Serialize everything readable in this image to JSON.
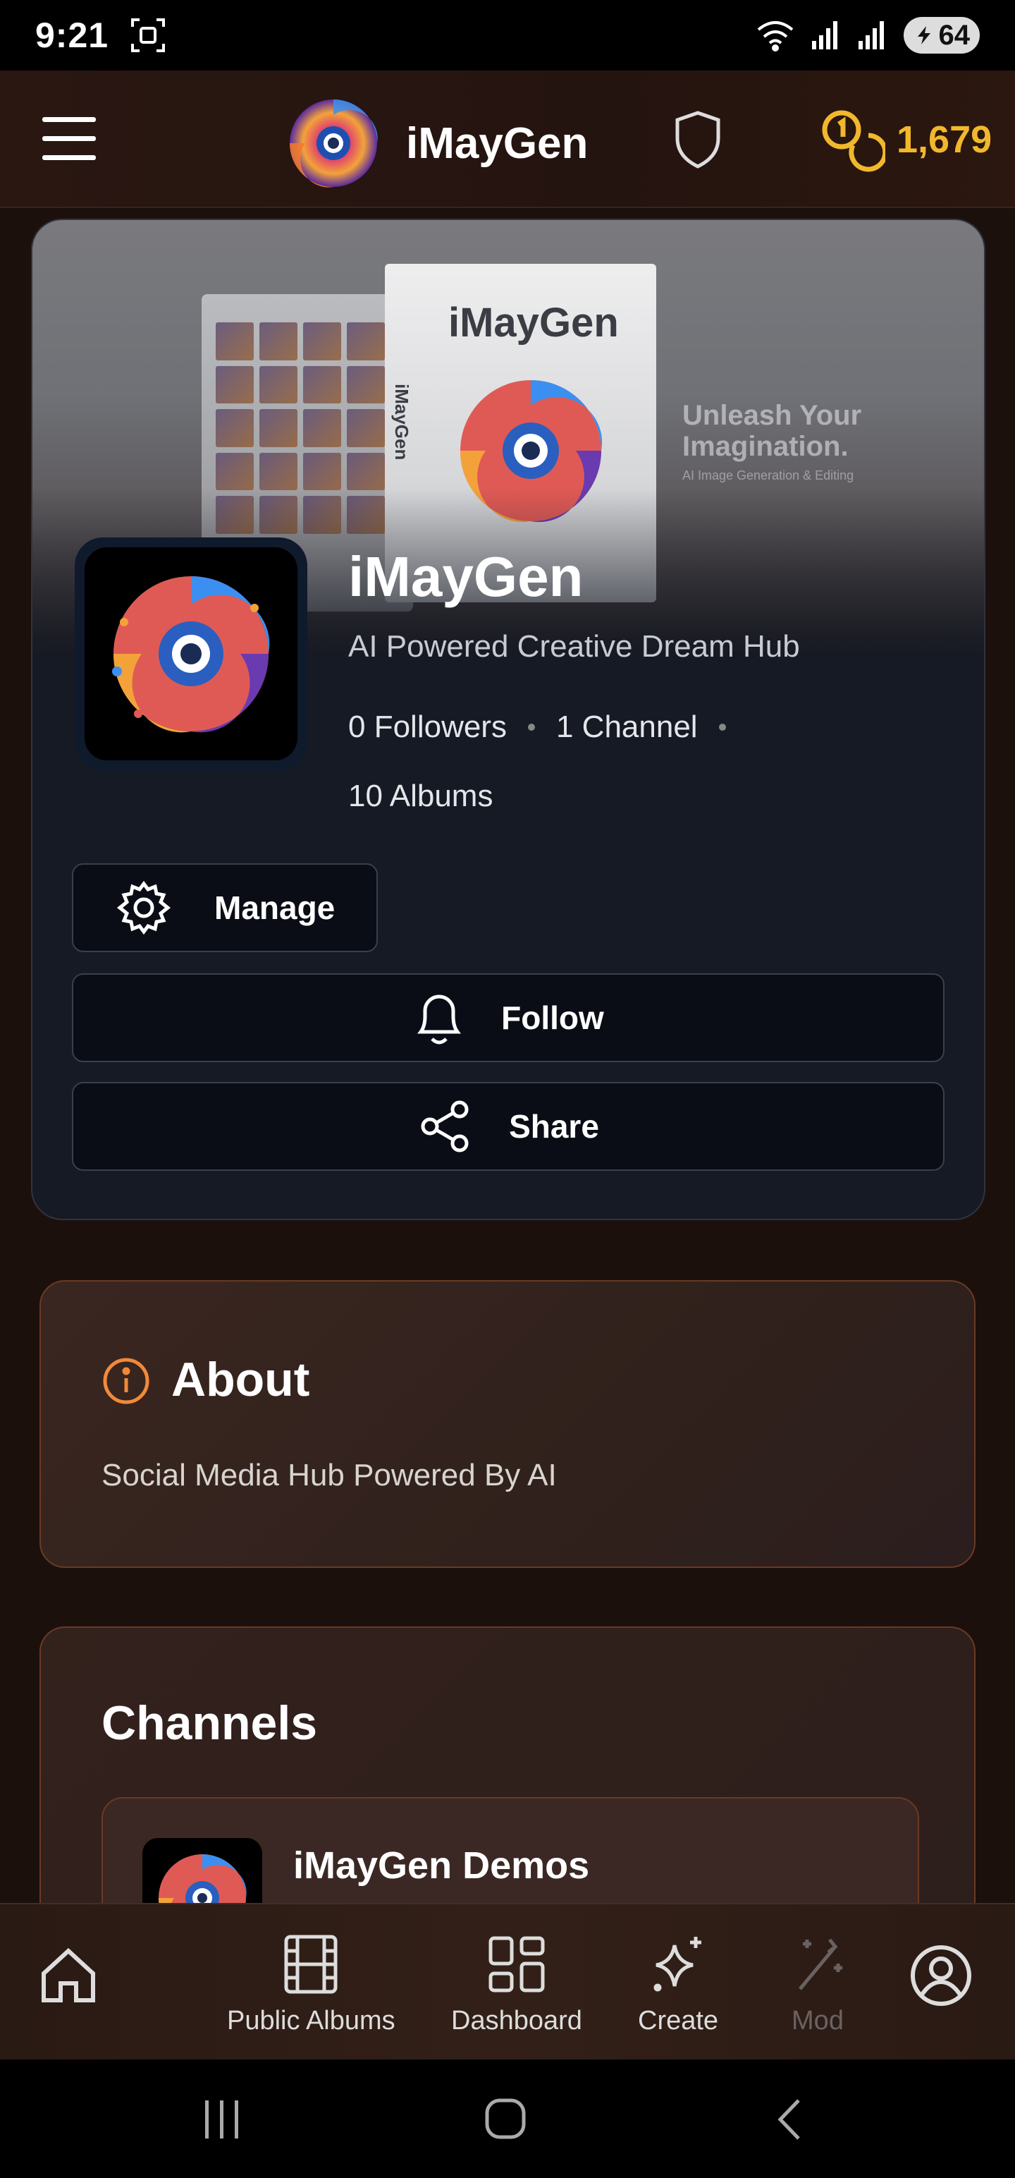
{
  "status_bar": {
    "time": "9:21",
    "battery": "64",
    "icons": [
      "screenshot-icon",
      "wifi-icon",
      "signal-icon",
      "signal-icon",
      "battery-icon"
    ]
  },
  "header": {
    "app_name": "iMayGen",
    "coins": "1,679",
    "icons": [
      "menu-icon",
      "shield-icon",
      "coins-icon"
    ]
  },
  "banner": {
    "box_title": "iMayGen",
    "box_spine": "iMayGen",
    "tagline": "Unleash Your Imagination.",
    "tagline_sub": "AI Image Generation & Editing"
  },
  "profile": {
    "name": "iMayGen",
    "tagline": "AI Powered Creative Dream Hub",
    "followers": "0 Followers",
    "channels": "1 Channel",
    "albums": "10 Albums",
    "manage_label": "Manage",
    "follow_label": "Follow",
    "share_label": "Share"
  },
  "about": {
    "title": "About",
    "text": "Social Media Hub Powered By AI"
  },
  "channels": {
    "title": "Channels",
    "items": [
      {
        "name": "iMayGen Demos"
      }
    ]
  },
  "bottom_nav": {
    "items": [
      {
        "label": "",
        "icon": "home-icon"
      },
      {
        "label": "Public Albums",
        "icon": "film-icon"
      },
      {
        "label": "Dashboard",
        "icon": "dashboard-icon"
      },
      {
        "label": "Create",
        "icon": "sparkle-icon"
      },
      {
        "label": "Mod",
        "icon": "magic-wand-icon"
      },
      {
        "label": "",
        "icon": "profile-icon"
      }
    ]
  },
  "colors": {
    "accent_gold": "#f1b82d",
    "about_icon": "#f08a3a",
    "card_border": "#6a3a22"
  }
}
